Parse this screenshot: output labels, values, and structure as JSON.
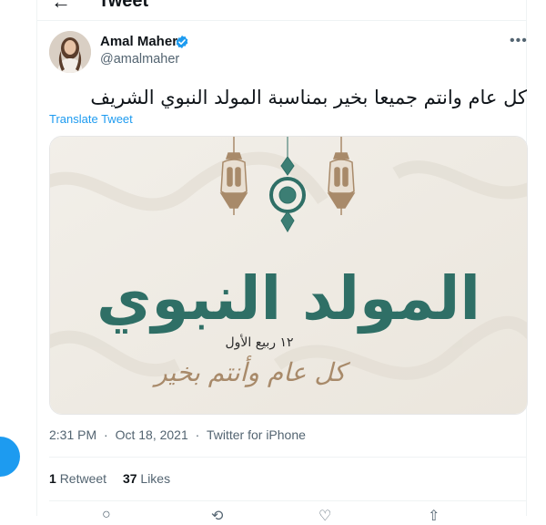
{
  "header": {
    "title": "Tweet",
    "back_icon": "arrow-left-icon"
  },
  "tweet": {
    "author_name": "Amal Maher",
    "handle": "@amalmaher",
    "verified": true,
    "text": "كل عام وانتم جميعا بخير بمناسبة المولد النبوي الشريف",
    "translate_label": "Translate Tweet",
    "media": {
      "title_calligraphy": "المولد النبوي",
      "date_line": "١٢ ربيع الأول",
      "greeting": "كل عام وأنتم بخير"
    },
    "time": "2:31 PM",
    "date": "Oct 18, 2021",
    "source": "Twitter for iPhone",
    "retweets": {
      "count": "1",
      "label": "Retweet"
    },
    "likes": {
      "count": "37",
      "label": "Likes"
    }
  },
  "colors": {
    "accent": "#1d9bf0",
    "secondary_text": "#536471",
    "text": "#0f1419",
    "calligraphy_green": "#2f6f66",
    "lantern": "#a88a6a"
  }
}
